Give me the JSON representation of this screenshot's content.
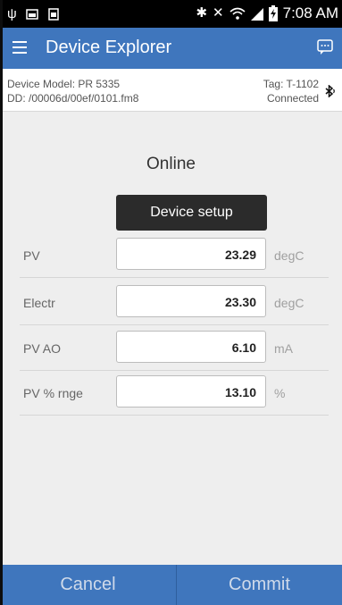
{
  "statusbar": {
    "time": "7:08 AM",
    "icons": [
      "usb-icon",
      "image-icon",
      "gallery-icon",
      "bluetooth-icon",
      "mute-icon",
      "wifi-icon",
      "signal-icon",
      "battery-charging-icon"
    ]
  },
  "appbar": {
    "title": "Device Explorer",
    "menu_icon": "hamburger-menu-icon",
    "chat_icon": "chat-bubble-icon"
  },
  "device_info": {
    "model": "Device Model: PR 5335",
    "dd": "DD: /00006d/00ef/0101.fm8",
    "tag": "Tag: T-1102",
    "status": "Connected",
    "bt_icon": "bluetooth-icon"
  },
  "main": {
    "status": "Online",
    "setup_button": "Device setup",
    "rows": [
      {
        "label": "PV",
        "value": "23.29",
        "unit": "degC"
      },
      {
        "label": "Electr",
        "value": "23.30",
        "unit": "degC"
      },
      {
        "label": "PV AO",
        "value": "6.10",
        "unit": "mA"
      },
      {
        "label": "PV % rnge",
        "value": "13.10",
        "unit": "%"
      }
    ]
  },
  "footer": {
    "cancel": "Cancel",
    "commit": "Commit"
  },
  "colors": {
    "accent": "#3f76bd",
    "background": "#eeeeee",
    "button_dark": "#2b2b2b"
  }
}
